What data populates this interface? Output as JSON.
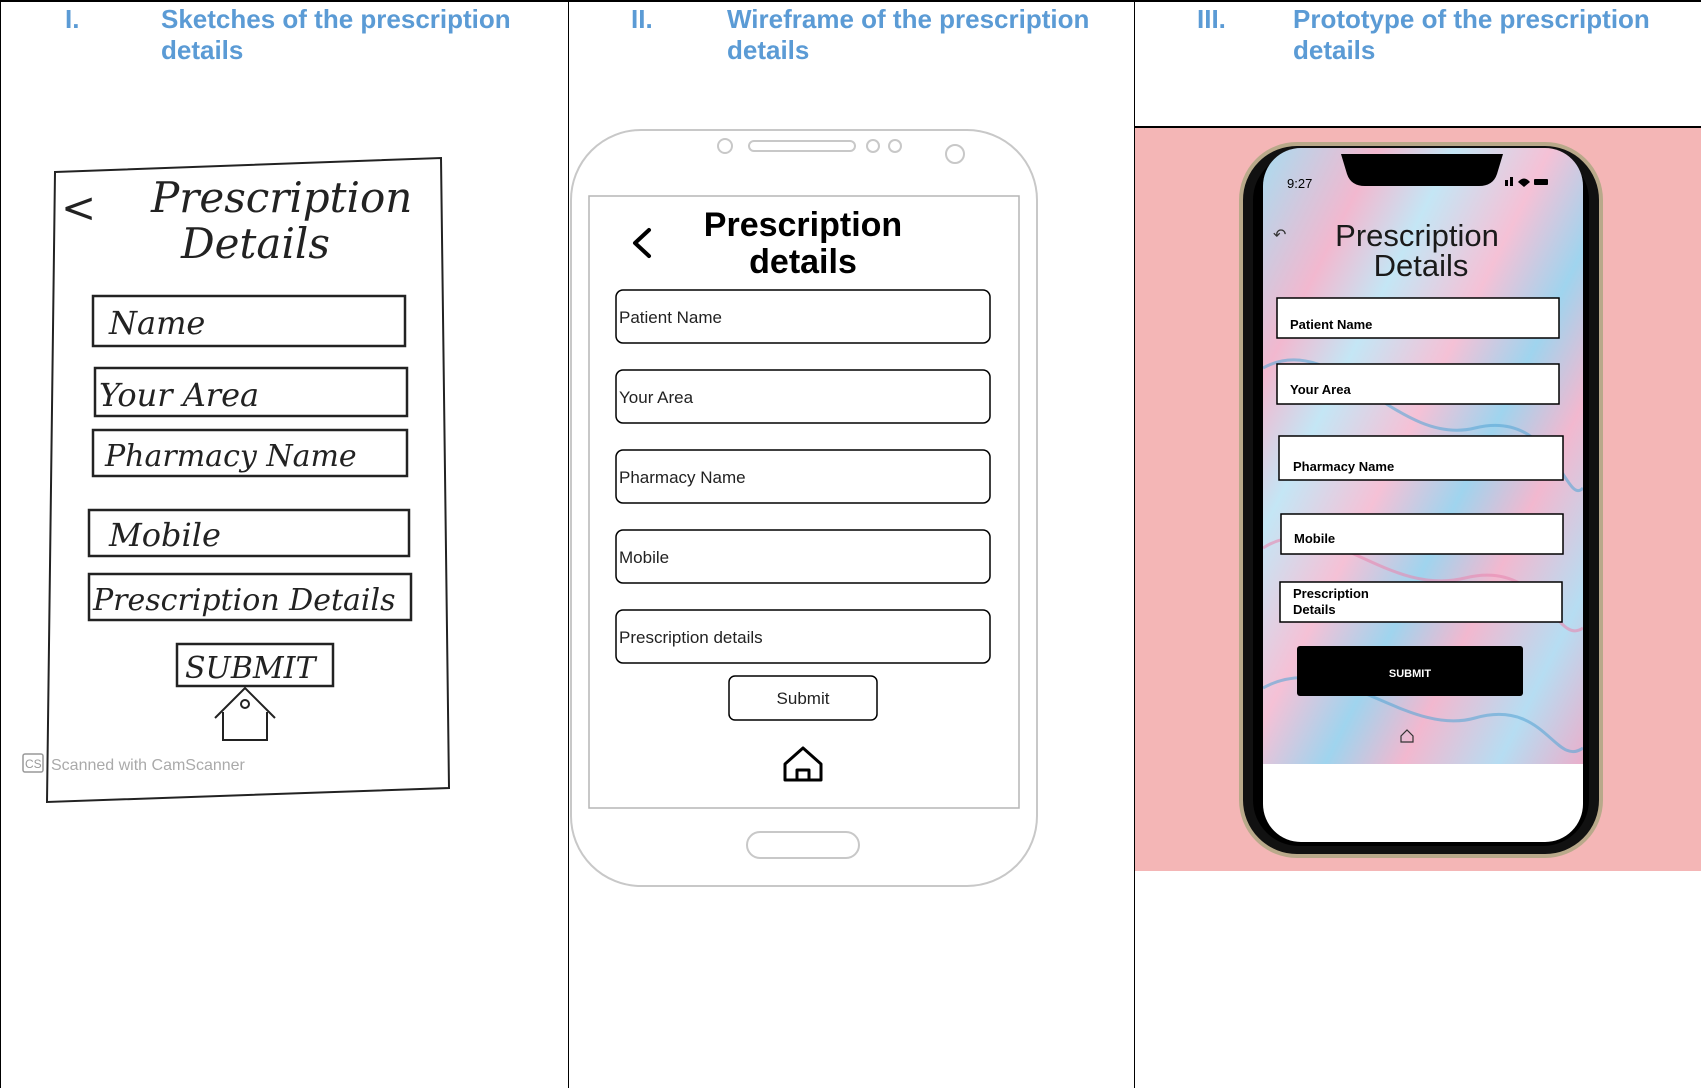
{
  "columns": [
    {
      "numeral": "I.",
      "heading": "Sketches of the prescription details"
    },
    {
      "numeral": "II.",
      "heading": "Wireframe of the prescription details"
    },
    {
      "numeral": "III.",
      "heading": "Prototype of the prescription details"
    }
  ],
  "sketch": {
    "back": "<",
    "title_line1": "Prescription",
    "title_line2": "Details",
    "fields": [
      "Name",
      "Your Area",
      "Pharmacy Name",
      "Mobile",
      "Prescription Details"
    ],
    "submit": "SUBMIT",
    "watermark_badge": "CS",
    "watermark_text": "Scanned with CamScanner"
  },
  "wireframe": {
    "back": "<",
    "title_line1": "Prescription",
    "title_line2": "details",
    "fields": [
      "Patient Name",
      "Your Area",
      "Pharmacy Name",
      "Mobile",
      "Prescription details"
    ],
    "submit": "Submit"
  },
  "prototype": {
    "time": "9:27",
    "back": "↶",
    "title_line1": "Prescription",
    "title_line2": "Details",
    "fields": [
      "Patient Name",
      "Your Area",
      "Pharmacy Name",
      "Mobile",
      "Prescription",
      "Details"
    ],
    "submit": "SUBMIT",
    "colors": {
      "background": "#f4b6b6",
      "submit": "#000000",
      "marble_blue": "#a9dcf0",
      "marble_pink": "#f2b8cf"
    }
  }
}
